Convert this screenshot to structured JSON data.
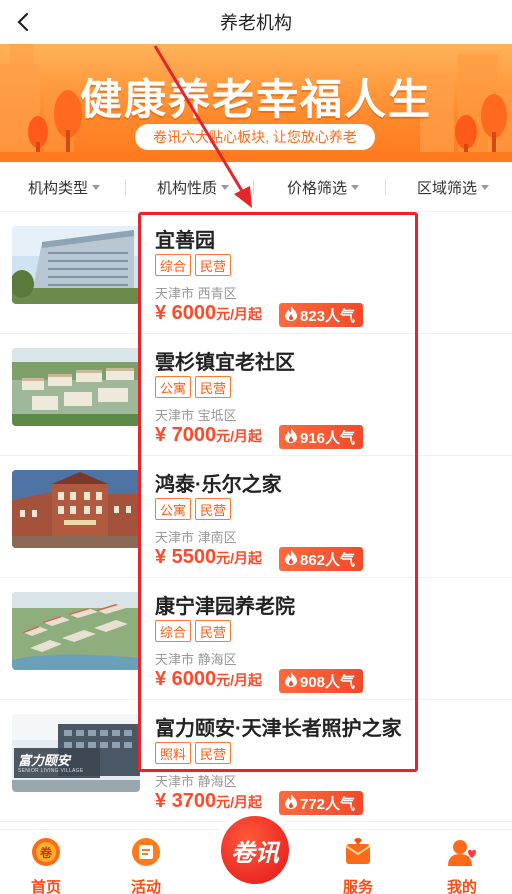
{
  "header": {
    "title": "养老机构",
    "back_icon": "chevron-left-icon"
  },
  "banner": {
    "title": "健康养老幸福人生",
    "subtitle": "卷讯六大贴心板块, 让您放心养老"
  },
  "filters": [
    {
      "label": "机构类型"
    },
    {
      "label": "机构性质"
    },
    {
      "label": "价格筛选"
    },
    {
      "label": "区域筛选"
    }
  ],
  "listings": [
    {
      "name": "宜善园",
      "tags": [
        "综合",
        "民营"
      ],
      "location": "天津市 西青区",
      "price": "¥ 6000",
      "unit": "元/月起",
      "popularity": "823人气",
      "image": "highrise-building"
    },
    {
      "name": "雲杉镇宜老社区",
      "tags": [
        "公寓",
        "民营"
      ],
      "location": "天津市 宝坻区",
      "price": "¥ 7000",
      "unit": "元/月起",
      "popularity": "916人气",
      "image": "aerial-community"
    },
    {
      "name": "鸿泰·乐尔之家",
      "tags": [
        "公寓",
        "民营"
      ],
      "location": "天津市 津南区",
      "price": "¥ 5500",
      "unit": "元/月起",
      "popularity": "862人气",
      "image": "european-building"
    },
    {
      "name": "康宁津园养老院",
      "tags": [
        "综合",
        "民营"
      ],
      "location": "天津市 静海区",
      "price": "¥ 6000",
      "unit": "元/月起",
      "popularity": "908人气",
      "image": "aerial-campus"
    },
    {
      "name": "富力颐安·天津长者照护之家",
      "tags": [
        "照料",
        "民营"
      ],
      "location": "天津市 静海区",
      "price": "¥ 3700",
      "unit": "元/月起",
      "popularity": "772人气",
      "image": "building-sign",
      "image_text": "富力颐安",
      "image_subtext": "SENIOR LIVING VILLAGE"
    }
  ],
  "bottom_nav": [
    {
      "label": "首页",
      "icon": "home-icon"
    },
    {
      "label": "活动",
      "icon": "activity-icon"
    },
    {
      "label": "卷讯",
      "icon": "brand-center-button"
    },
    {
      "label": "服务",
      "icon": "service-icon"
    },
    {
      "label": "我的",
      "icon": "profile-icon"
    }
  ],
  "colors": {
    "accent": "#ff5a12",
    "price": "#ff4a2a",
    "annotation": "#e6252a",
    "banner": "#ff8a2c"
  }
}
